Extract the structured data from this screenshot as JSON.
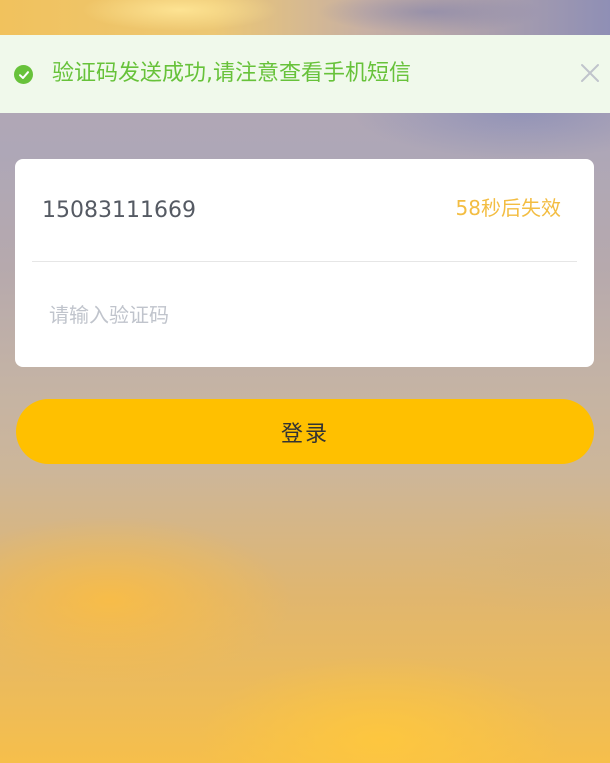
{
  "toast": {
    "message": "验证码发送成功,请注意查看手机短信",
    "type": "success",
    "icon": "check-circle-icon",
    "close_icon": "close-icon",
    "color": "#67c23a",
    "background": "#f0f9eb"
  },
  "form": {
    "phone_value": "15083111669",
    "countdown_text": "58秒后失效",
    "code_placeholder": "请输入验证码",
    "code_value": ""
  },
  "actions": {
    "login_label": "登录",
    "button_color": "#ffc000"
  }
}
